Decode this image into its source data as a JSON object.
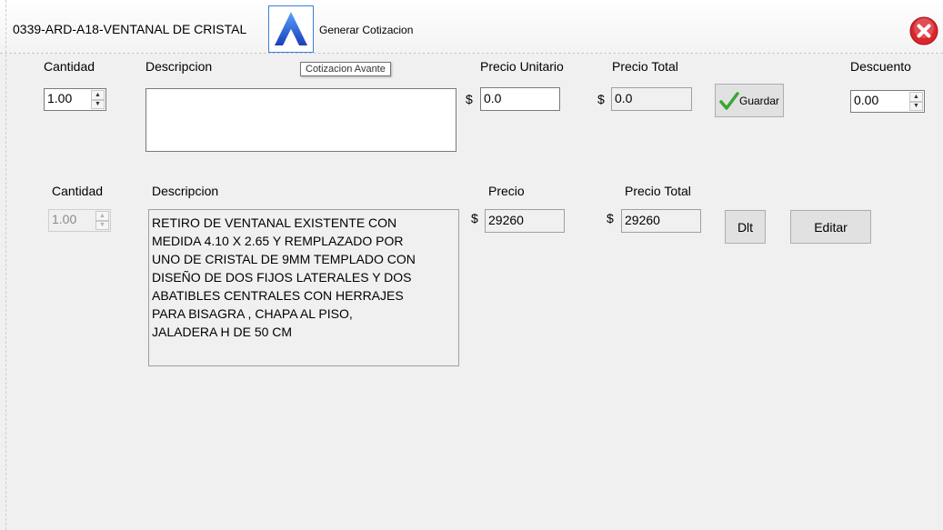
{
  "header": {
    "title": "0339-ARD-A18-VENTANAL DE CRISTAL",
    "generate_label": "Generar Cotizacion",
    "logo_letter": "A"
  },
  "tooltip": "Cotizacion Avante",
  "new_item": {
    "quantity_label": "Cantidad",
    "quantity_value": "1.00",
    "description_label": "Descripcion",
    "description_value": "",
    "unit_price_label": "Precio Unitario",
    "unit_price_value": "0.0",
    "total_label": "Precio Total",
    "total_value": "0.0",
    "currency": "$",
    "save_label": "Guardar",
    "discount_label": "Descuento",
    "discount_value": "0.00"
  },
  "items_header": {
    "quantity": "Cantidad",
    "description": "Descripcion",
    "price": "Precio",
    "total": "Precio Total"
  },
  "items": [
    {
      "quantity": "1.00",
      "description": "RETIRO DE VENTANAL EXISTENTE CON MEDIDA 4.10 X 2.65 Y REMPLAZADO POR UNO DE CRISTAL DE 9MM TEMPLADO CON DISEÑO DE DOS FIJOS LATERALES Y DOS ABATIBLES CENTRALES CON HERRAJES PARA BISAGRA , CHAPA AL PISO, JALADERA H DE 50 CM",
      "description_lines": [
        "RETIRO DE VENTANAL EXISTENTE CON",
        "MEDIDA 4.10 X 2.65 Y REMPLAZADO POR",
        "UNO DE CRISTAL DE 9MM TEMPLADO CON",
        "DISEÑO DE DOS FIJOS LATERALES Y DOS",
        "ABATIBLES CENTRALES CON HERRAJES",
        "PARA BISAGRA , CHAPA AL PISO,",
        "JALADERA H DE 50 CM"
      ],
      "price": "29260",
      "total": "29260",
      "currency": "$",
      "delete_label": "Dlt",
      "edit_label": "Editar"
    }
  ],
  "colors": {
    "accent": "#3d7ddb",
    "close": "#d9262c",
    "check": "#3aa635"
  }
}
